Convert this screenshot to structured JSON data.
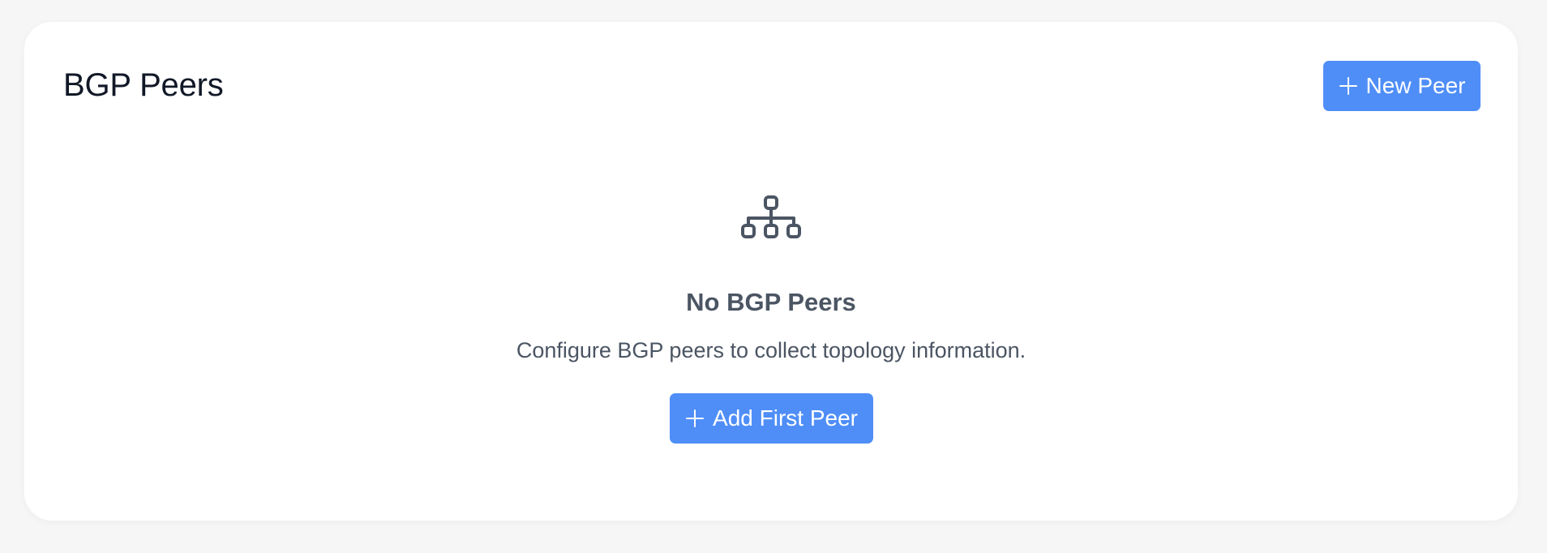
{
  "card": {
    "title": "BGP Peers",
    "new_button_label": "New Peer",
    "new_button_icon": "plus-icon"
  },
  "empty_state": {
    "icon": "network-topology-icon",
    "title": "No BGP Peers",
    "description": "Configure BGP peers to collect topology information.",
    "button_label": "Add First Peer",
    "button_icon": "plus-icon"
  },
  "colors": {
    "accent": "#4f8ef7",
    "title_text": "#111827",
    "muted_text": "#4b5563",
    "background": "#f6f6f7",
    "card": "#ffffff"
  }
}
